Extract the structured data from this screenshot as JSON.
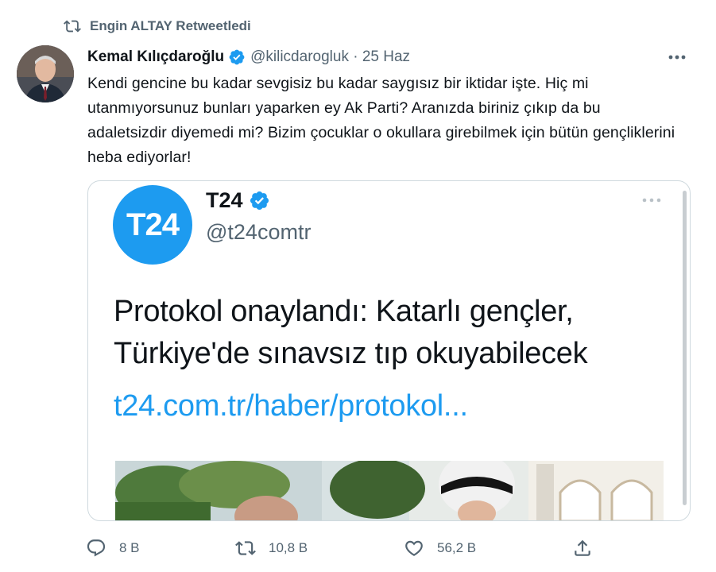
{
  "retweet_banner": {
    "text": "Engin ALTAY Retweetledi"
  },
  "tweet": {
    "author_name": "Kemal Kılıçdaroğlu",
    "meta": "@kilicdarogluk · 25 Haz",
    "text": "Kendi gencine bu kadar sevgisiz bu kadar saygısız bir iktidar işte. Hiç mi utanmıyorsunuz bunları yaparken ey Ak Parti? Aranızda biriniz çıkıp da bu adaletsizdir diyemedi mi? Bizim çocuklar o okullara girebilmek için bütün gençliklerini heba ediyorlar!"
  },
  "embedded_card": {
    "logo_text": "T24",
    "source_name": "T24",
    "source_handle": "@t24comtr",
    "headline": "Protokol onaylandı: Katarlı gençler, Türkiye'de sınavsız tıp okuyabilecek",
    "link": "t24.com.tr/haber/protokol..."
  },
  "actions": {
    "reply_count": "8 B",
    "retweet_count": "10,8 B",
    "like_count": "56,2 B"
  },
  "icons": [
    "retweet-icon",
    "verified-badge-icon",
    "more-options-icon",
    "reply-icon",
    "like-icon",
    "share-icon"
  ],
  "colors": {
    "accent": "#1d9bf0",
    "secondary_text": "#536471",
    "border": "#cfd9de"
  }
}
